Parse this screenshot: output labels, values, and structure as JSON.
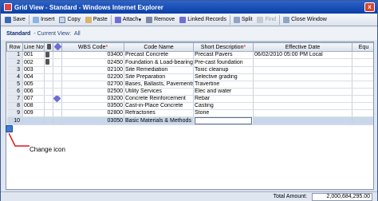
{
  "window": {
    "title": "Grid View - Standard - Windows Internet Explorer",
    "close_glyph": "x"
  },
  "toolbar": {
    "save": "Save",
    "insert": "Insert",
    "copy": "Copy",
    "paste": "Paste",
    "attach": "Attach",
    "remove": "Remove",
    "linked_records": "Linked Records",
    "split": "Split",
    "find": "Find",
    "close_window": "Close Window",
    "attach_arrow": "▾"
  },
  "view": {
    "standard": "Standard",
    "current_view_label": "- Current View:",
    "current_view": "All"
  },
  "grid": {
    "headers": {
      "row": "Row",
      "line_no": "Line No",
      "wbs_code": "WBS Code",
      "code_name": "Code Name",
      "short_description": "Short Description",
      "effective_date": "Effective Date",
      "equ": "Equ",
      "required_mark": "*",
      "sort_arrow": "▾"
    },
    "rows": [
      {
        "row": "1",
        "line_no": "001",
        "doc": true,
        "clip": false,
        "wbs_code": "03400",
        "code_name": "Precast Concrete",
        "short_description": "Precast Pavers",
        "effective_date": "06/02/2010 05:00 PM Local"
      },
      {
        "row": "2",
        "line_no": "002",
        "doc": true,
        "clip": false,
        "wbs_code": "02450",
        "code_name": "Foundation & Load-bearing",
        "short_description": "Pre-cast foundation",
        "effective_date": ""
      },
      {
        "row": "3",
        "line_no": "003",
        "doc": false,
        "clip": false,
        "wbs_code": "02100",
        "code_name": "Site Remediation",
        "short_description": "Toxic cleanup",
        "effective_date": ""
      },
      {
        "row": "4",
        "line_no": "004",
        "doc": false,
        "clip": false,
        "wbs_code": "02200",
        "code_name": "Site Preparation",
        "short_description": "Selective grading",
        "effective_date": ""
      },
      {
        "row": "5",
        "line_no": "005",
        "doc": false,
        "clip": false,
        "wbs_code": "02700",
        "code_name": "Bases, Ballasts, Pavements,",
        "short_description": "Travertine",
        "effective_date": ""
      },
      {
        "row": "6",
        "line_no": "006",
        "doc": false,
        "clip": false,
        "wbs_code": "02500",
        "code_name": "Utility Services",
        "short_description": "Elec and water",
        "effective_date": ""
      },
      {
        "row": "7",
        "line_no": "007",
        "doc": false,
        "clip": true,
        "wbs_code": "03200",
        "code_name": "Concrete Reinforcement",
        "short_description": "Rebar",
        "effective_date": ""
      },
      {
        "row": "8",
        "line_no": "008",
        "doc": false,
        "clip": false,
        "wbs_code": "03500",
        "code_name": "Cast-in-Place Concrete",
        "short_description": "Casting",
        "effective_date": ""
      },
      {
        "row": "9",
        "line_no": "009",
        "doc": false,
        "clip": false,
        "wbs_code": "02800",
        "code_name": "Refractories",
        "short_description": "Stone",
        "effective_date": ""
      },
      {
        "row": "10",
        "line_no": "",
        "doc": false,
        "clip": false,
        "wbs_code": "03050",
        "code_name": "Basic Materials & Methods",
        "short_description": "",
        "effective_date": "",
        "selected": true
      }
    ]
  },
  "annotation": {
    "label": "Change icon"
  },
  "footer": {
    "total_label": "Total Amount:",
    "total_value": "2,000,684,295.00"
  },
  "colors": {
    "title_bar": "#2d63c8",
    "selected_row": "#c9d7ea",
    "required": "#dd0000"
  }
}
